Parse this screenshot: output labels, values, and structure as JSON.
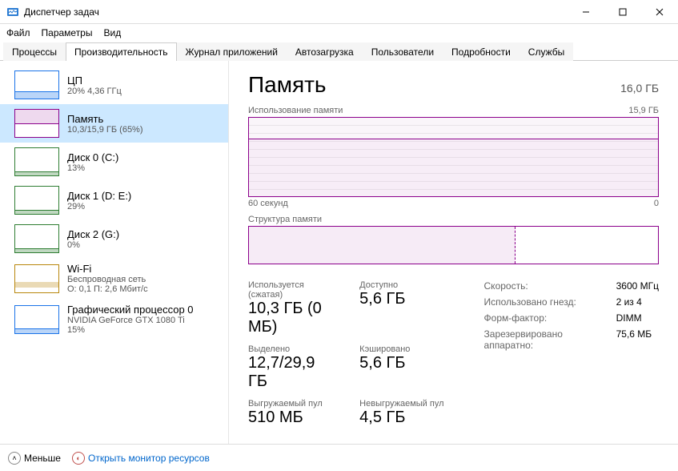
{
  "window": {
    "title": "Диспетчер задач"
  },
  "menu": {
    "file": "Файл",
    "options": "Параметры",
    "view": "Вид"
  },
  "tabs": {
    "processes": "Процессы",
    "performance": "Производительность",
    "apphistory": "Журнал приложений",
    "startup": "Автозагрузка",
    "users": "Пользователи",
    "details": "Подробности",
    "services": "Службы"
  },
  "sidebar": [
    {
      "title": "ЦП",
      "sub": "20% 4,36 ГГц",
      "type": "cpu"
    },
    {
      "title": "Память",
      "sub": "10,3/15,9 ГБ (65%)",
      "type": "mem"
    },
    {
      "title": "Диск 0 (C:)",
      "sub": "13%",
      "type": "disk"
    },
    {
      "title": "Диск 1 (D: E:)",
      "sub": "29%",
      "type": "disk"
    },
    {
      "title": "Диск 2 (G:)",
      "sub": "0%",
      "type": "disk"
    },
    {
      "title": "Wi-Fi",
      "sub": "Беспроводная сеть",
      "sub2": "О: 0,1 П: 2,6 Мбит/с",
      "type": "net"
    },
    {
      "title": "Графический процессор 0",
      "sub": "NVIDIA GeForce GTX 1080 Ti",
      "sub2": "15%",
      "type": "gpu"
    }
  ],
  "detail": {
    "heading": "Память",
    "total": "16,0 ГБ",
    "usage_label": "Использование памяти",
    "usage_max": "15,9 ГБ",
    "time_left": "60 секунд",
    "time_right": "0",
    "struct_label": "Структура памяти",
    "stats_left": [
      {
        "k": "Используется (сжатая)",
        "v": "10,3 ГБ (0 МБ)"
      },
      {
        "k": "Доступно",
        "v": "5,6 ГБ"
      },
      {
        "k": "Выделено",
        "v": "12,7/29,9 ГБ"
      },
      {
        "k": "Кэшировано",
        "v": "5,6 ГБ"
      },
      {
        "k": "Выгружаемый пул",
        "v": "510 МБ"
      },
      {
        "k": "Невыгружаемый пул",
        "v": "4,5 ГБ"
      }
    ],
    "stats_right": [
      {
        "k": "Скорость:",
        "v": "3600 МГц"
      },
      {
        "k": "Использовано гнезд:",
        "v": "2 из 4"
      },
      {
        "k": "Форм-фактор:",
        "v": "DIMM"
      },
      {
        "k": "Зарезервировано аппаратно:",
        "v": "75,6 МБ"
      }
    ]
  },
  "footer": {
    "less": "Меньше",
    "resmon": "Открыть монитор ресурсов"
  }
}
